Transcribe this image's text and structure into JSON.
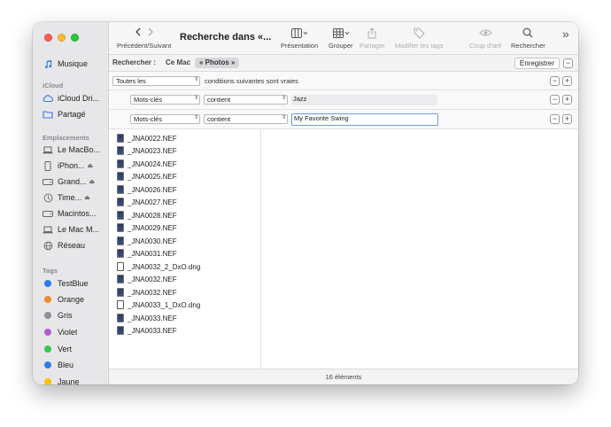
{
  "window": {
    "title": "Recherche dans «..."
  },
  "toolbar": {
    "nav_label": "Précédent/Suivant",
    "presentation_label": "Présentation",
    "group_label": "Grouper",
    "share_label": "Partager",
    "tags_label": "Modifier les tags",
    "quicklook_label": "Coup d'œil",
    "search_label": "Rechercher",
    "more": "»"
  },
  "sidebar": {
    "top_item": {
      "label": "Musique",
      "icon": "music-note-icon"
    },
    "icloud_header": "iCloud",
    "icloud_items": [
      {
        "label": "iCloud Dri...",
        "icon": "cloud-icon"
      },
      {
        "label": "Partagé",
        "icon": "shared-folder-icon"
      }
    ],
    "locations_header": "Emplacements",
    "locations": [
      {
        "label": "Le MacBo...",
        "icon": "laptop-icon",
        "eject": ""
      },
      {
        "label": "iPhon...",
        "icon": "phone-icon",
        "eject": "⏏"
      },
      {
        "label": "Grand...",
        "icon": "disk-icon",
        "eject": "⏏"
      },
      {
        "label": "Time...",
        "icon": "time-machine-icon",
        "eject": "⏏"
      },
      {
        "label": "Macintos...",
        "icon": "disk-icon",
        "eject": ""
      },
      {
        "label": "Le Mac M...",
        "icon": "laptop-icon",
        "eject": ""
      },
      {
        "label": "Réseau",
        "icon": "network-globe-icon",
        "eject": ""
      }
    ],
    "tags_header": "Tags",
    "tags": [
      {
        "label": "TestBlue",
        "color": "#2b7de9"
      },
      {
        "label": "Orange",
        "color": "#f0892b"
      },
      {
        "label": "Gris",
        "color": "#8e8e93"
      },
      {
        "label": "Violet",
        "color": "#b05fc9"
      },
      {
        "label": "Vert",
        "color": "#34c759"
      },
      {
        "label": "Bleu",
        "color": "#2b7de9"
      },
      {
        "label": "Jaune",
        "color": "#f5c300"
      }
    ]
  },
  "scope": {
    "label": "Rechercher :",
    "mac": "Ce Mac",
    "photos": "« Photos »",
    "save": "Enregistrer"
  },
  "criteria": {
    "match": "Toutes les",
    "match_suffix": "conditions suivantes sont vraies",
    "rows": [
      {
        "attribute": "Mots-clés",
        "operator": "contient",
        "value": "Jazz"
      },
      {
        "attribute": "Mots-clés",
        "operator": "contient",
        "value": "My Favorite Swing"
      }
    ]
  },
  "files": [
    {
      "name": "_JNA0022.NEF",
      "kind": "photo"
    },
    {
      "name": "_JNA0023.NEF",
      "kind": "photo"
    },
    {
      "name": "_JNA0024.NEF",
      "kind": "photo"
    },
    {
      "name": "_JNA0025.NEF",
      "kind": "photo"
    },
    {
      "name": "_JNA0026.NEF",
      "kind": "photo"
    },
    {
      "name": "_JNA0027.NEF",
      "kind": "photo"
    },
    {
      "name": "_JNA0028.NEF",
      "kind": "photo"
    },
    {
      "name": "_JNA0029.NEF",
      "kind": "photo"
    },
    {
      "name": "_JNA0030.NEF",
      "kind": "photo"
    },
    {
      "name": "_JNA0031.NEF",
      "kind": "photo"
    },
    {
      "name": "_JNA0032_2_DxO.dng",
      "kind": "dng"
    },
    {
      "name": "_JNA0032.NEF",
      "kind": "photo"
    },
    {
      "name": "_JNA0032.NEF",
      "kind": "photo"
    },
    {
      "name": "_JNA0033_1_DxO.dng",
      "kind": "dng"
    },
    {
      "name": "_JNA0033.NEF",
      "kind": "photo"
    },
    {
      "name": "_JNA0033.NEF",
      "kind": "photo"
    }
  ],
  "status": {
    "count": "16 éléments"
  }
}
